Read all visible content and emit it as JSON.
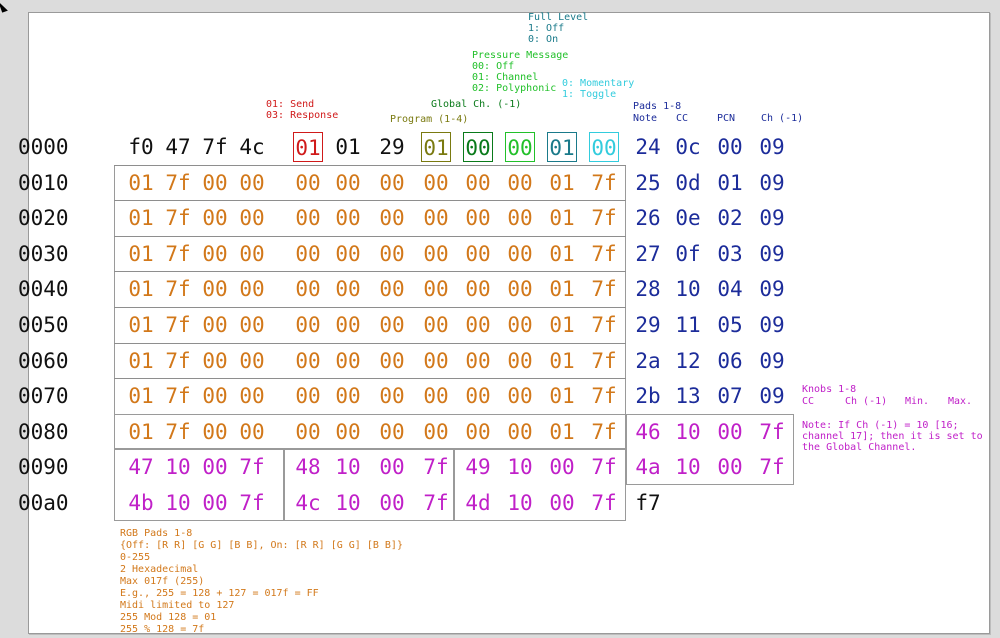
{
  "annotations": {
    "fader_level": {
      "title": "Full Level",
      "l1": "1: Off",
      "l2": "0: On"
    },
    "pressure": {
      "title": "Pressure Message",
      "l1": "00: Off",
      "l2": "01: Channel",
      "l3": "02: Polyphonic"
    },
    "pad_mode": {
      "l1": "0: Momentary",
      "l2": "1: Toggle"
    },
    "send_resp": {
      "l1": "01: Send",
      "l2": "03: Response"
    },
    "global_ch": "Global Ch. (-1)",
    "program": "Program (1-4)",
    "pads_header": {
      "title": "Pads 1-8",
      "c1": "Note",
      "c2": "CC",
      "c3": "PCN",
      "c4": "Ch (-1)"
    },
    "knobs_header": {
      "title": "Knobs 1-8",
      "c1": "CC",
      "c2": "Ch (-1)",
      "c3": "Min.",
      "c4": "Max."
    },
    "knob_note": {
      "l1": "Note: If Ch (-1) = 10 [16;",
      "l2": "channel 17]; then it is set to",
      "l3": "the Global Channel."
    },
    "rgb_note": {
      "l1": "RGB Pads 1-8",
      "l2": "{Off: [R R] [G G] [B B], On: [R R] [G G] [B B]}",
      "l3": "0-255",
      "l4": "2 Hexadecimal",
      "l5": "Max 017f (255)",
      "l6": "E.g., 255 = 128 + 127 = 017f = FF",
      "l7": "Midi limited to 127",
      "l8": "255 Mod 128 = 01",
      "l9": "255 % 128 = 7f"
    }
  },
  "rows": [
    {
      "addr": "0000",
      "bytes": [
        "f0",
        "47",
        "7f",
        "4c",
        "01",
        "01",
        "29",
        "01",
        "00",
        "00",
        "01",
        "00",
        "24",
        "0c",
        "00",
        "09"
      ]
    },
    {
      "addr": "0010",
      "bytes": [
        "01",
        "7f",
        "00",
        "00",
        "00",
        "00",
        "00",
        "00",
        "00",
        "00",
        "01",
        "7f",
        "25",
        "0d",
        "01",
        "09"
      ]
    },
    {
      "addr": "0020",
      "bytes": [
        "01",
        "7f",
        "00",
        "00",
        "00",
        "00",
        "00",
        "00",
        "00",
        "00",
        "01",
        "7f",
        "26",
        "0e",
        "02",
        "09"
      ]
    },
    {
      "addr": "0030",
      "bytes": [
        "01",
        "7f",
        "00",
        "00",
        "00",
        "00",
        "00",
        "00",
        "00",
        "00",
        "01",
        "7f",
        "27",
        "0f",
        "03",
        "09"
      ]
    },
    {
      "addr": "0040",
      "bytes": [
        "01",
        "7f",
        "00",
        "00",
        "00",
        "00",
        "00",
        "00",
        "00",
        "00",
        "01",
        "7f",
        "28",
        "10",
        "04",
        "09"
      ]
    },
    {
      "addr": "0050",
      "bytes": [
        "01",
        "7f",
        "00",
        "00",
        "00",
        "00",
        "00",
        "00",
        "00",
        "00",
        "01",
        "7f",
        "29",
        "11",
        "05",
        "09"
      ]
    },
    {
      "addr": "0060",
      "bytes": [
        "01",
        "7f",
        "00",
        "00",
        "00",
        "00",
        "00",
        "00",
        "00",
        "00",
        "01",
        "7f",
        "2a",
        "12",
        "06",
        "09"
      ]
    },
    {
      "addr": "0070",
      "bytes": [
        "01",
        "7f",
        "00",
        "00",
        "00",
        "00",
        "00",
        "00",
        "00",
        "00",
        "01",
        "7f",
        "2b",
        "13",
        "07",
        "09"
      ]
    },
    {
      "addr": "0080",
      "bytes": [
        "01",
        "7f",
        "00",
        "00",
        "00",
        "00",
        "00",
        "00",
        "00",
        "00",
        "01",
        "7f",
        "46",
        "10",
        "00",
        "7f"
      ]
    },
    {
      "addr": "0090",
      "bytes": [
        "47",
        "10",
        "00",
        "7f",
        "48",
        "10",
        "00",
        "7f",
        "49",
        "10",
        "00",
        "7f",
        "4a",
        "10",
        "00",
        "7f"
      ]
    },
    {
      "addr": "00a0",
      "bytes": [
        "4b",
        "10",
        "00",
        "7f",
        "4c",
        "10",
        "00",
        "7f",
        "4d",
        "10",
        "00",
        "7f",
        "f7"
      ]
    }
  ],
  "colors": {
    "default": "#111111",
    "rgb": "#d2781a",
    "pads": "#1c2c9a",
    "knobs": "#c020c8",
    "send": "#d01a1a",
    "program": "#7a7a10",
    "global": "#0a7a1a",
    "pressure": "#22c02a",
    "fader": "#1a7a8a",
    "padmode": "#33ccdd"
  }
}
